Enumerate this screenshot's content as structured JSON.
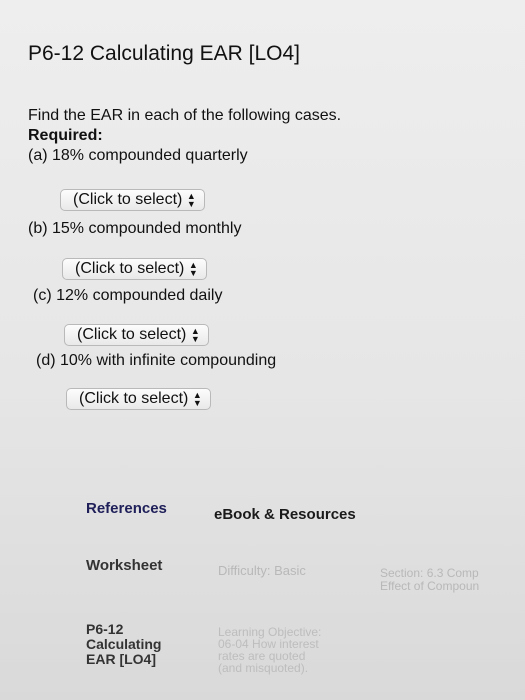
{
  "title": "P6-12 Calculating EAR [LO4]",
  "intro": "Find the EAR in each of the following cases.",
  "required": "Required:",
  "cases": [
    {
      "label": "(a) 18% compounded quarterly",
      "select": "(Click to select)"
    },
    {
      "label": "(b) 15% compounded monthly",
      "select": "(Click to select)"
    },
    {
      "label": "(c) 12% compounded daily",
      "select": "(Click to select)"
    },
    {
      "label": "(d) 10% with infinite compounding",
      "select": "(Click to select)"
    }
  ],
  "tabs": {
    "references": "References",
    "ebook": "eBook & Resources"
  },
  "worksheet": {
    "label": "Worksheet",
    "difficulty": "Difficulty: Basic",
    "section_line1": "Section: 6.3 Comp",
    "section_line2": "Effect of Compoun"
  },
  "footer": {
    "problem_line1": "P6-12",
    "problem_line2": "Calculating",
    "problem_line3": "EAR [LO4]",
    "objective_line1": "Learning Objective:",
    "objective_line2": "06-04 How interest",
    "objective_line3": "rates are quoted",
    "objective_line4": "(and misquoted)."
  },
  "icons": {
    "dropdown": "updown-arrows-icon"
  }
}
